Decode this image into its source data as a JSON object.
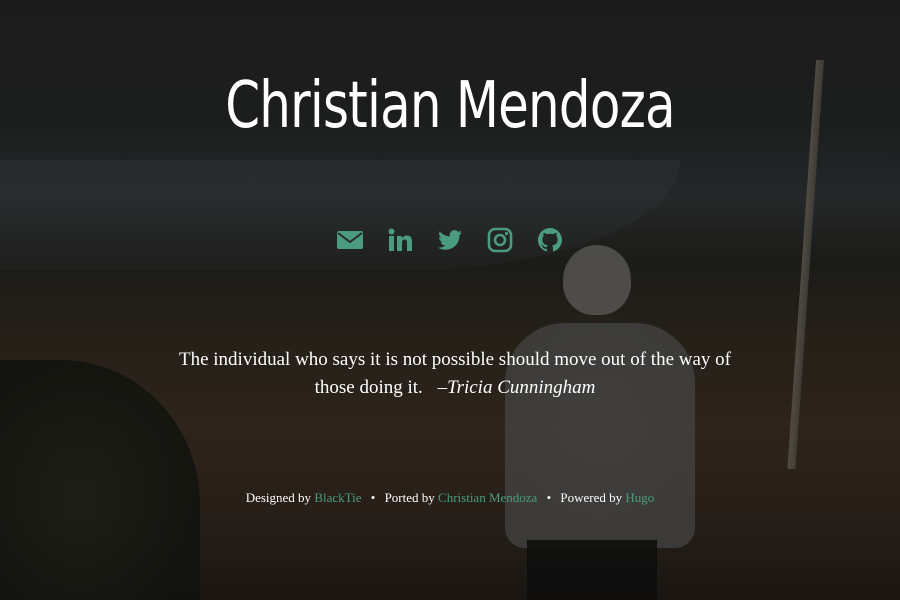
{
  "header": {
    "title": "Christian Mendoza"
  },
  "social": {
    "accent_color": "#4a9b80",
    "icons": [
      "envelope-icon",
      "linkedin-icon",
      "twitter-icon",
      "instagram-icon",
      "github-icon"
    ]
  },
  "quote": {
    "text": "The individual who says it is not possible should move out of the way of those doing it.",
    "author": "–Tricia Cunningham"
  },
  "footer": {
    "designed_prefix": "Designed by",
    "designed_link": "BlackTie",
    "separator": "•",
    "ported_prefix": "Ported by",
    "ported_link": "Christian Mendoza",
    "powered_prefix": "Powered by",
    "powered_link": "Hugo"
  }
}
